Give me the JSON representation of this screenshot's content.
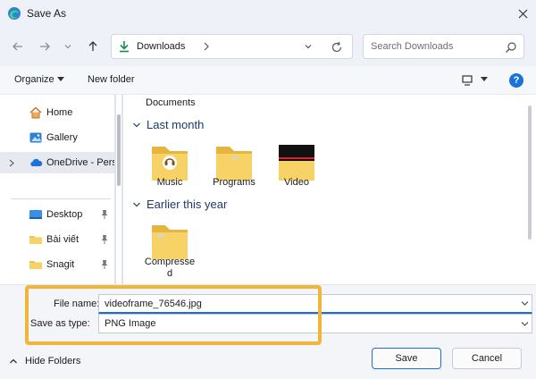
{
  "window": {
    "title": "Save As",
    "close_icon": "close-icon",
    "app_icon": "edge-icon"
  },
  "nav": {
    "back_icon": "arrow-left-icon",
    "forward_icon": "arrow-right-icon",
    "dropdown_icon": "chevron-down-icon",
    "up_icon": "arrow-up-icon",
    "address": "Downloads",
    "search_placeholder": "Search Downloads"
  },
  "toolbar": {
    "organize": "Organize",
    "new_folder": "New folder",
    "help": "?"
  },
  "sidebar": {
    "items": [
      {
        "label": "Home",
        "icon": "home-icon"
      },
      {
        "label": "Gallery",
        "icon": "gallery-icon"
      },
      {
        "label": "OneDrive - Perso",
        "icon": "cloud-icon",
        "selected": true
      },
      {
        "label": "Desktop",
        "icon": "desktop-icon",
        "pinned": true
      },
      {
        "label": "Bài viết",
        "icon": "folder-icon",
        "pinned": true
      },
      {
        "label": "Snagit",
        "icon": "folder-icon",
        "pinned": true
      }
    ]
  },
  "main": {
    "partial_label": "Documents",
    "groups": [
      {
        "title": "Last month",
        "folders": [
          {
            "label": "Music",
            "icon": "music-folder-icon"
          },
          {
            "label": "Programs",
            "icon": "folder-icon"
          },
          {
            "label": "Video",
            "icon": "video-folder-icon"
          }
        ]
      },
      {
        "title": "Earlier this year",
        "folders": [
          {
            "label_line1": "Compresse",
            "label_line2": "d",
            "icon": "folder-icon"
          }
        ]
      }
    ]
  },
  "form": {
    "filename_label": "File name:",
    "filename_value": "videoframe_76546.jpg",
    "type_label": "Save as type:",
    "type_value": "PNG Image"
  },
  "footer": {
    "hide_folders": "Hide Folders",
    "save": "Save",
    "cancel": "Cancel"
  },
  "colors": {
    "accent": "#1a6fd0",
    "highlight": "#f0b63a",
    "folder": "#f7cf5b"
  }
}
